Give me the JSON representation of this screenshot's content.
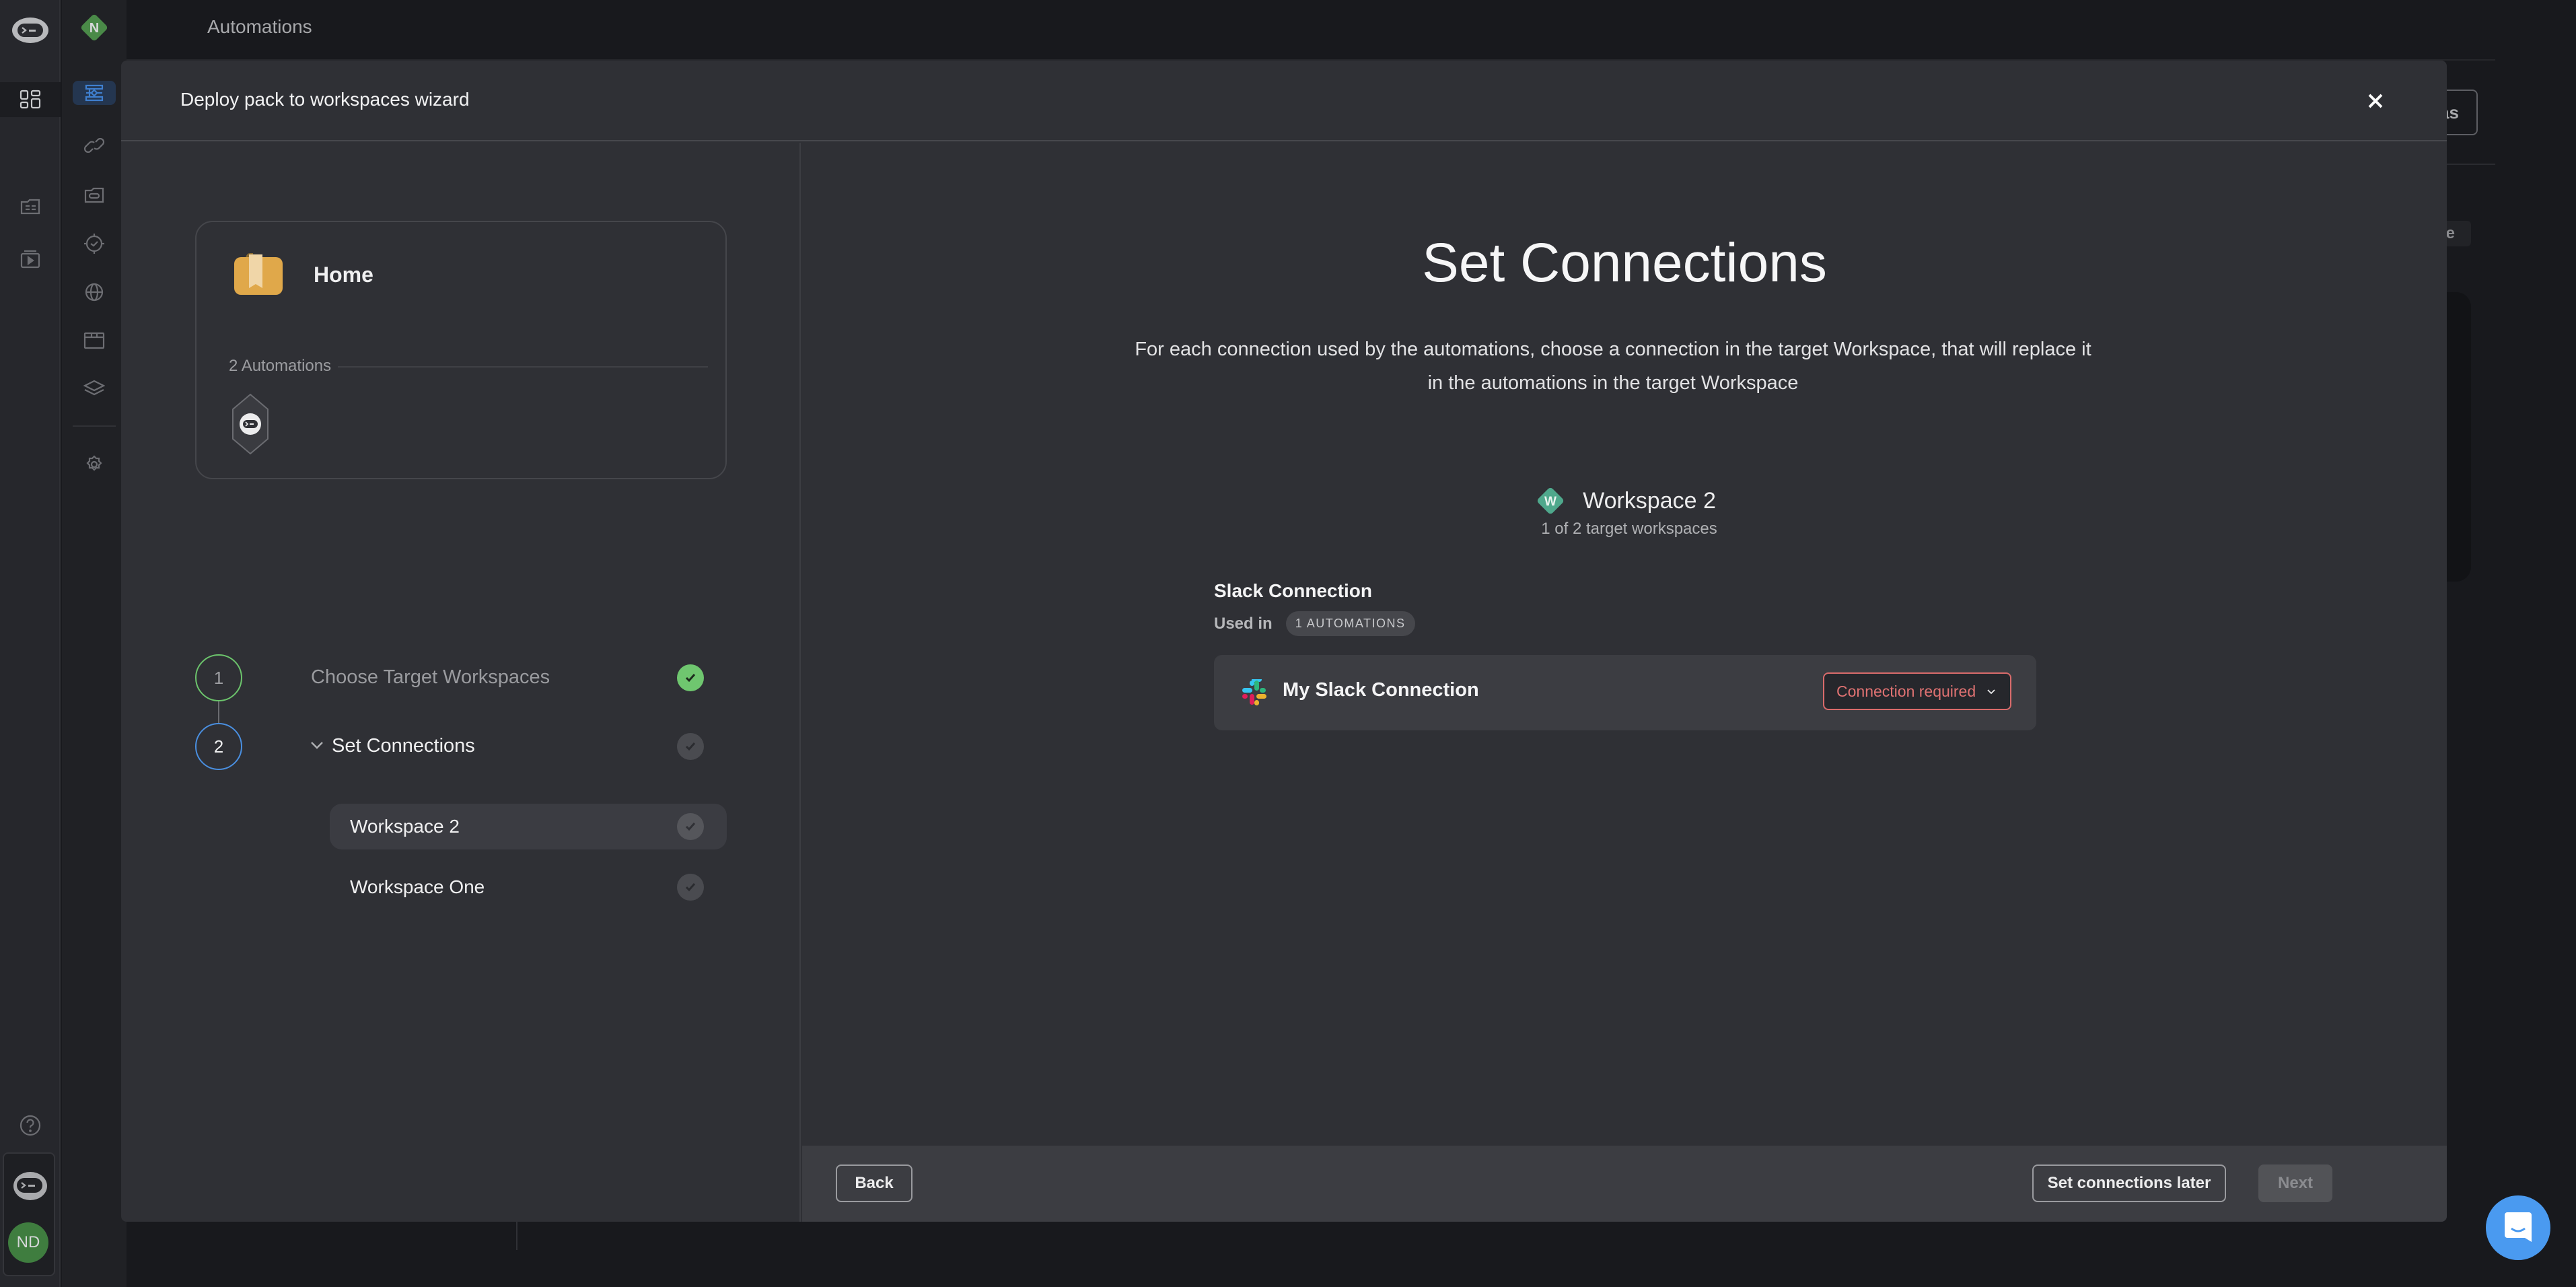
{
  "app": {
    "page_title": "Automations",
    "workspace_badge_letter": "N",
    "user_initials": "ND"
  },
  "rail_primary": {
    "items": [
      {
        "icon": "logo-icon",
        "label": "Home"
      },
      {
        "icon": "pie-chart-icon",
        "label": "Dashboard"
      },
      {
        "icon": "grid-icon",
        "label": "Workspaces",
        "active": true
      },
      {
        "icon": "folder-icon",
        "label": "Packs"
      },
      {
        "icon": "media-icon",
        "label": "Media"
      }
    ],
    "bottom": [
      {
        "icon": "help-icon",
        "label": "Help"
      },
      {
        "icon": "logo-icon",
        "label": "Assistant"
      }
    ]
  },
  "rail_secondary": {
    "items": [
      {
        "icon": "automations-icon",
        "label": "Automations",
        "active": true
      },
      {
        "icon": "link-icon",
        "label": "Connections"
      },
      {
        "icon": "folder-link-icon",
        "label": "Shared connections"
      },
      {
        "icon": "badge-check-icon",
        "label": "Approvals"
      },
      {
        "icon": "globe-icon",
        "label": "Web"
      },
      {
        "icon": "window-icon",
        "label": "Apps"
      },
      {
        "icon": "layers-icon",
        "label": "Layers"
      },
      {
        "icon": "settings-icon",
        "label": "Settings"
      }
    ]
  },
  "background": {
    "button_1_partial": "as",
    "button_2_partial": "e"
  },
  "modal": {
    "title": "Deploy pack to workspaces wizard",
    "close_label": "Close",
    "pack": {
      "name": "Home",
      "automation_count_label": "2 Automations",
      "icon_color": "#e0a84a"
    },
    "steps": [
      {
        "number": "1",
        "label": "Choose Target Workspaces",
        "status": "complete"
      },
      {
        "number": "2",
        "label": "Set Connections",
        "status": "current",
        "expanded": true,
        "sub_items": [
          {
            "label": "Workspace 2",
            "selected": true,
            "status": "pending"
          },
          {
            "label": "Workspace One",
            "selected": false,
            "status": "pending"
          }
        ]
      }
    ],
    "main": {
      "title": "Set Connections",
      "description": "For each connection used by the automations, choose a connection in the target Workspace, that will replace it in the automations in the target Workspace",
      "workspace": {
        "badge_letter": "W",
        "badge_color": "#4fa88c",
        "name": "Workspace 2",
        "progress_label": "1 of 2 target workspaces"
      },
      "connection": {
        "type_title": "Slack Connection",
        "used_in_label": "Used in",
        "usage_badge": "1 AUTOMATIONS",
        "source_name": "My Slack Connection",
        "select_value": "Connection required",
        "select_error_color": "#e07272"
      }
    },
    "footer": {
      "back_label": "Back",
      "later_label": "Set connections later",
      "next_label": "Next",
      "next_disabled": true
    }
  },
  "chat": {
    "label": "Open chat"
  }
}
